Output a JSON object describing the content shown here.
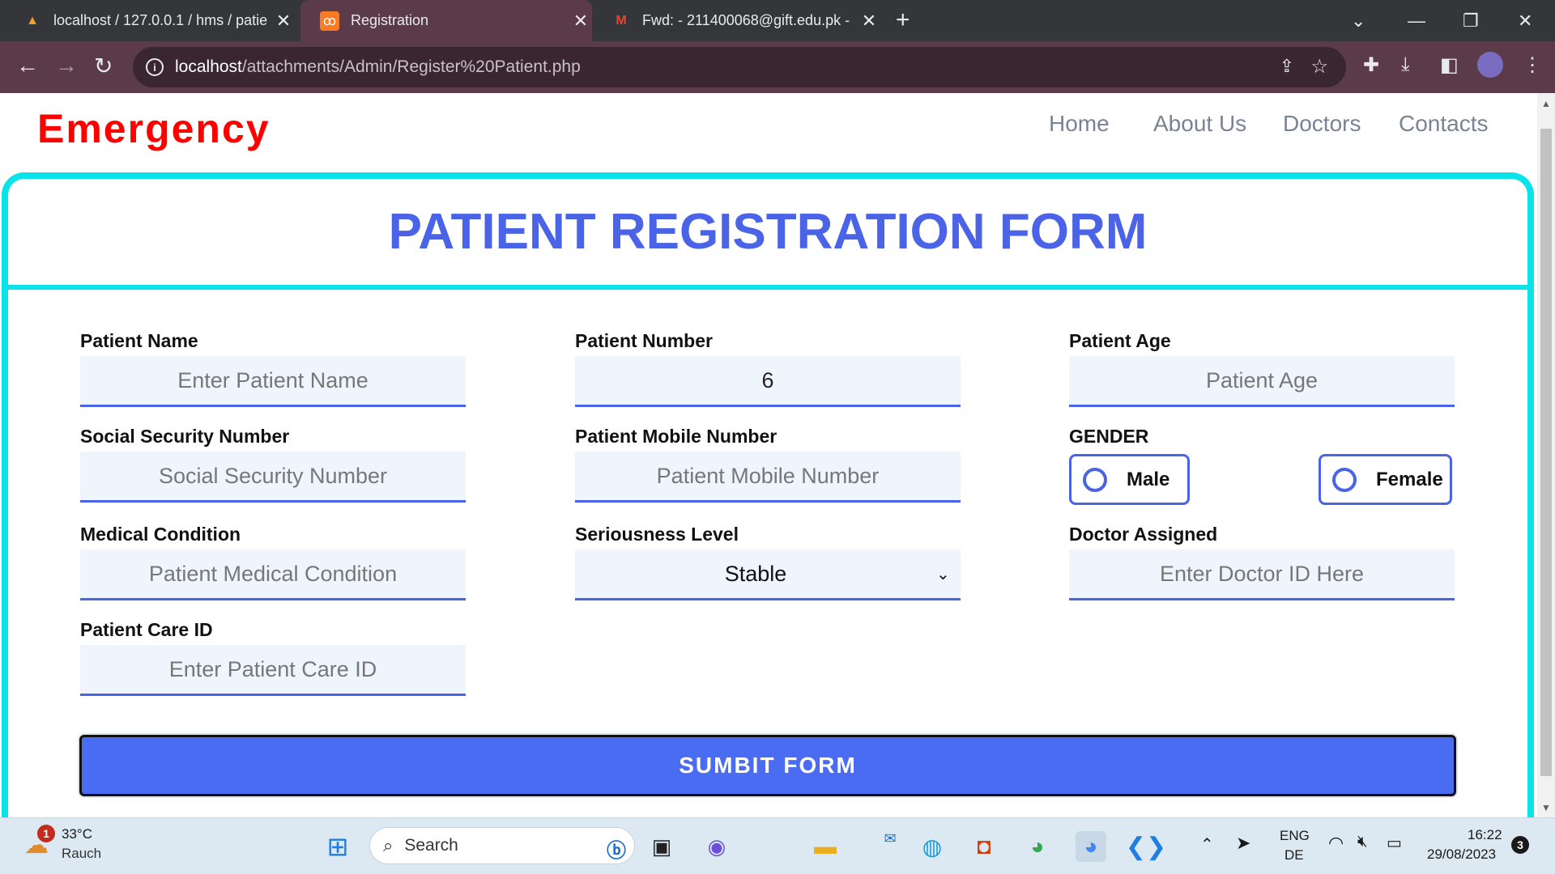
{
  "browser": {
    "tabs": [
      {
        "title": "localhost / 127.0.0.1 / hms / patie",
        "icon": "phpmyadmin-icon"
      },
      {
        "title": "Registration",
        "icon": "xampp-icon"
      },
      {
        "title": "Fwd: - 211400068@gift.edu.pk - ",
        "icon": "gmail-icon"
      }
    ],
    "url_host": "localhost",
    "url_path": "/attachments/Admin/Register%20Patient.php"
  },
  "site": {
    "brand": "Emergency",
    "nav": [
      "Home",
      "About Us",
      "Doctors",
      "Contacts"
    ]
  },
  "form": {
    "title": "PATIENT REGISTRATION FORM",
    "patient_name": {
      "label": "Patient Name",
      "placeholder": "Enter Patient Name"
    },
    "patient_number": {
      "label": "Patient Number",
      "value": "6"
    },
    "patient_age": {
      "label": "Patient Age",
      "placeholder": "Patient Age"
    },
    "ssn": {
      "label": "Social Security Number",
      "placeholder": "Social Security Number"
    },
    "mobile": {
      "label": "Patient Mobile Number",
      "placeholder": "Patient Mobile Number"
    },
    "gender": {
      "label": "GENDER",
      "options": [
        "Male",
        "Female"
      ]
    },
    "medical_condition": {
      "label": "Medical Condition",
      "placeholder": "Patient Medical Condition"
    },
    "seriousness": {
      "label": "Seriousness Level",
      "value": "Stable"
    },
    "doctor": {
      "label": "Doctor Assigned",
      "placeholder": "Enter Doctor ID Here"
    },
    "care_id": {
      "label": "Patient Care ID",
      "placeholder": "Enter Patient Care ID"
    },
    "submit": "SUMBIT FORM"
  },
  "taskbar": {
    "weather_temp": "33°C",
    "weather_desc": "Rauch",
    "weather_badge": "1",
    "search": "Search",
    "lang1": "ENG",
    "lang2": "DE",
    "time": "16:22",
    "date": "29/08/2023",
    "notif_count": "3"
  },
  "colors": {
    "brand": "#ff0000",
    "accent": "#4a63e7",
    "frame": "#0be3ea",
    "chrome": "#5b3b49"
  }
}
